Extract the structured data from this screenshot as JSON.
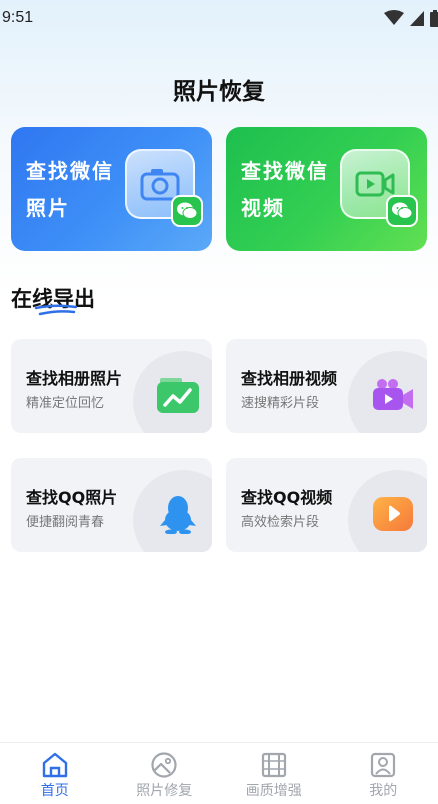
{
  "status_bar": {
    "time": "9:51"
  },
  "page": {
    "title": "照片恢复"
  },
  "hero_cards": [
    {
      "line1": "查找微信",
      "line2": "照片",
      "icon": "camera-icon"
    },
    {
      "line1": "查找微信",
      "line2": "视频",
      "icon": "video-icon"
    }
  ],
  "section": {
    "title": "在线导出"
  },
  "cards": [
    {
      "title": "查找相册照片",
      "subtitle": "精准定位回忆",
      "icon": "photo-icon"
    },
    {
      "title": "查找相册视频",
      "subtitle": "速搜精彩片段",
      "icon": "video-camera-icon"
    },
    {
      "title": "查找QQ照片",
      "subtitle": "便捷翻阅青春",
      "icon": "qq-penguin-icon"
    },
    {
      "title": "查找QQ视频",
      "subtitle": "高效检索片段",
      "icon": "play-icon"
    }
  ],
  "tabbar": {
    "items": [
      {
        "label": "首页",
        "icon": "home-icon",
        "active": true
      },
      {
        "label": "照片修复",
        "icon": "image-icon",
        "active": false
      },
      {
        "label": "画质增强",
        "icon": "film-icon",
        "active": false
      },
      {
        "label": "我的",
        "icon": "profile-icon",
        "active": false
      }
    ]
  },
  "colors": {
    "accent": "#2f6fe8",
    "blue_card": "#2f77f1",
    "green_card": "#1ebf4f",
    "card_bg": "#f1f3f7"
  }
}
